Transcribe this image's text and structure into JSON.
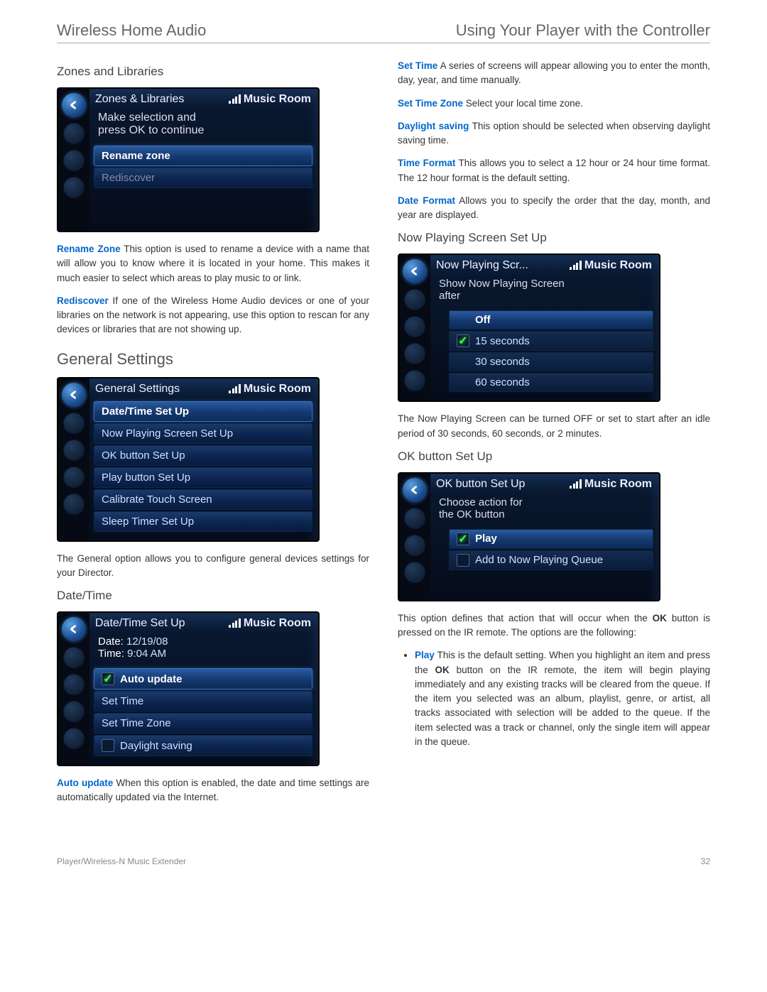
{
  "header": {
    "left": "Wireless Home Audio",
    "right": "Using Your Player with the Controller"
  },
  "footer": {
    "left": "Player/Wireless-N Music Extender",
    "pageno": "32"
  },
  "left": {
    "h_zones": "Zones and Libraries",
    "scr_zones": {
      "title": "Zones & Libraries",
      "room": "Music Room",
      "instr1": "Make selection and",
      "instr2": "press OK to continue",
      "row_rename": "Rename zone",
      "row_rediscov": "Rediscover"
    },
    "p_rename_term": "Rename Zone",
    "p_rename_body": " This option is used to rename a device with a name that will allow you to know where it is located in your home. This makes it much easier to select which areas to play music to or link.",
    "p_redis_term": "Rediscover",
    "p_redis_body": "  If one of the Wireless Home Audio devices or one of your libraries on the network is not appearing, use this option to rescan for any devices or libraries that are not showing up.",
    "h_general": "General Settings",
    "scr_general": {
      "title": "General Settings",
      "room": "Music Room",
      "rows": [
        "Date/Time Set Up",
        "Now Playing Screen Set Up",
        "OK button Set Up",
        "Play button Set Up",
        "Calibrate Touch Screen",
        "Sleep Timer Set Up"
      ]
    },
    "p_general": "The General option allows you to configure general devices settings for your Director.",
    "h_datetime": "Date/Time",
    "scr_dt": {
      "title": "Date/Time Set Up",
      "room": "Music Room",
      "date_label": "Date:",
      "date_val": "12/19/08",
      "time_label": "Time:",
      "time_val": "9:04 AM",
      "row_auto": "Auto update",
      "row_settime": "Set Time",
      "row_settz": "Set Time Zone",
      "row_daylight": "Daylight saving"
    },
    "p_auto_term": "Auto update",
    "p_auto_body": "  When this option is enabled, the date and time settings are automatically updated via the Internet."
  },
  "right": {
    "p_settime_term": "Set Time",
    "p_settime_body": "  A series of screens will appear allowing you to enter the month, day, year, and time manually.",
    "p_settz_term": "Set Time Zone",
    "p_settz_body": "  Select your local time zone.",
    "p_day_term": "Daylight saving",
    "p_day_body": " This option should be selected when observing daylight saving time.",
    "p_tf_term": "Time Format",
    "p_tf_body": "   This allows you to select a 12 hour or 24 hour time format. The 12 hour format is the default setting.",
    "p_df_term": "Date Format",
    "p_df_body": "   Allows you to specify the order that the day, month, and year are displayed.",
    "h_now": "Now Playing Screen Set Up",
    "scr_np": {
      "title": "Now Playing Scr...",
      "room": "Music Room",
      "instr1": "Show Now Playing Screen",
      "instr2": "after",
      "row_off": "Off",
      "rows": [
        "15 seconds",
        "30 seconds",
        "60 seconds"
      ]
    },
    "p_np": "The Now Playing Screen can be turned OFF or set to start after an idle period of 30 seconds, 60 seconds, or 2 minutes.",
    "h_ok": "OK button Set Up",
    "scr_ok": {
      "title": "OK button Set Up",
      "room": "Music Room",
      "instr1": "Choose action for",
      "instr2": "the OK button",
      "row_play": "Play",
      "row_add": "Add to Now Playing Queue"
    },
    "p_ok_1a": "This option defines that action that will occur when the ",
    "p_ok_1b": "OK",
    "p_ok_1c": " button is pressed on the IR remote. The options are the following:",
    "li_play_term": "Play",
    "li_play_a": "   This is the default setting. When you highlight an item and press the ",
    "li_play_b": "OK",
    "li_play_c": " button on the IR remote, the item will begin playing immediately and any existing tracks will be cleared from the queue. If the item you selected was an album, playlist, genre, or artist, all tracks associated with selection will be added to the queue. If the item selected was a track or channel, only the single item will appear in the queue."
  }
}
